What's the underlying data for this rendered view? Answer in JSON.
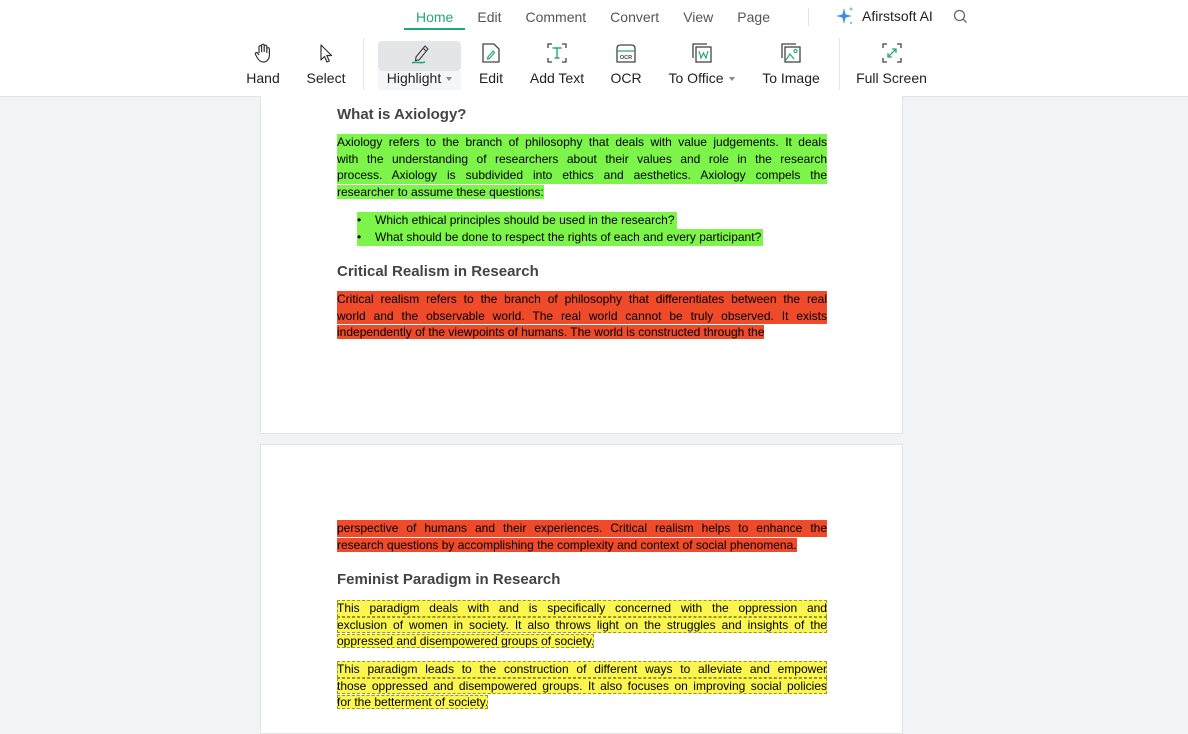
{
  "menu": {
    "tabs": [
      {
        "label": "Home",
        "active": true
      },
      {
        "label": "Edit",
        "active": false
      },
      {
        "label": "Comment",
        "active": false
      },
      {
        "label": "Convert",
        "active": false
      },
      {
        "label": "View",
        "active": false
      },
      {
        "label": "Page",
        "active": false
      }
    ],
    "ai_label": "Afirstsoft AI",
    "ai_icon": "sparkle-icon",
    "search_icon": "search-icon",
    "accent_color": "#23a874"
  },
  "toolbar": {
    "hand": "Hand",
    "select": "Select",
    "highlight": "Highlight",
    "edit": "Edit",
    "add_text": "Add Text",
    "ocr": "OCR",
    "to_office": "To Office",
    "to_image": "To Image",
    "full_screen": "Full Screen"
  },
  "document": {
    "page1": {
      "heading1": "What is Axiology?",
      "para1": [
        "Axiology refers to the branch of philosophy that deals with value judgements. It deals",
        "with the understanding of researchers about their values and role in the research",
        "process. Axiology is subdivided into ethics and aesthetics. Axiology compels the",
        "researcher to assume these questions:"
      ],
      "bullets": [
        "Which ethical principles should be used in the research?",
        "What should be done to respect the rights of each and every participant?"
      ],
      "heading2": "Critical Realism in Research",
      "para2": [
        "Critical realism refers to the branch of philosophy that differentiates between the real",
        "world and the observable world. The real world cannot be truly observed. It exists",
        "independently of the viewpoints of humans. The world is constructed through the"
      ]
    },
    "page2": {
      "para1": [
        "perspective of humans and their experiences. Critical realism helps to enhance the",
        "research questions by accomplishing the complexity and context of social phenomena."
      ],
      "heading1": "Feminist Paradigm in Research",
      "para2": [
        "This paradigm deals with and is specifically concerned with the oppression and",
        "exclusion of women in society. It also throws light on the struggles and insights of the",
        "oppressed and disempowered groups of society."
      ],
      "para3": [
        "This paradigm leads to the construction of different ways to alleviate and empower",
        "those oppressed and disempowered groups. It also focuses on improving social policies",
        "for the betterment of society."
      ]
    },
    "highlight_colors": {
      "green": "#7cf44a",
      "red": "#ef4a2a",
      "yellow": "#fbf64f"
    }
  }
}
